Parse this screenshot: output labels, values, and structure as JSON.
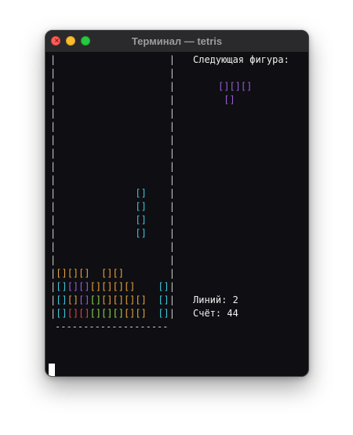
{
  "window": {
    "title": "Терминал — tetris"
  },
  "colors": {
    "orange": "#e8a33a",
    "cyan": "#3fc7d9",
    "purple": "#9a5fd6",
    "red": "#e04444",
    "green": "#8ed04a",
    "wall": "#cfcfcf",
    "background": "#0e0e13"
  },
  "game": {
    "next_label": "Следующая фигура:",
    "next_piece": [
      "[][][]",
      " []"
    ],
    "next_piece_color": "purple",
    "lines_label": "Линий: 2",
    "score_label": "Счёт: 44",
    "floor": "--------------------",
    "board": [
      "          ",
      "          ",
      "          ",
      "          ",
      "          ",
      "          ",
      "          ",
      "          ",
      "          ",
      "          ",
      "       c  ",
      "       c  ",
      "       c  ",
      "       c  ",
      "          ",
      "          ",
      "ooo oo    ",
      "cppoooo  c",
      "copgoooo c",
      "crrgggoo c"
    ]
  }
}
